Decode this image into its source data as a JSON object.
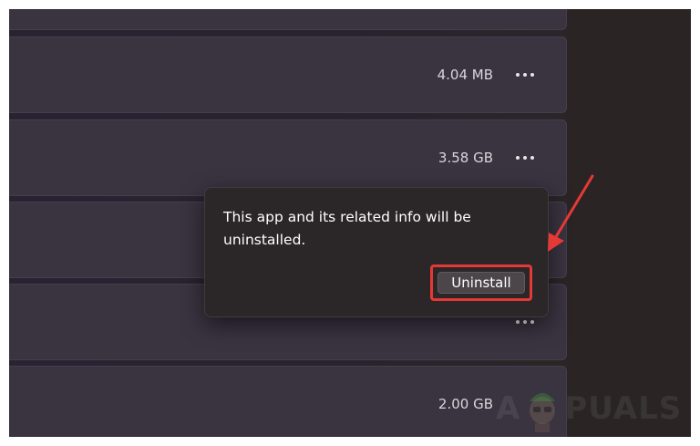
{
  "app_list": {
    "items": [
      {
        "size": ""
      },
      {
        "size": "4.04 MB"
      },
      {
        "size": "3.58 GB"
      },
      {
        "size": ""
      },
      {
        "size": ""
      },
      {
        "size": "2.00 GB"
      }
    ]
  },
  "uninstall_flyout": {
    "message": "This app and its related info will be uninstalled.",
    "button_label": "Uninstall"
  },
  "watermark": {
    "text_left": "A",
    "text_right": "PUALS"
  },
  "colors": {
    "annotation_red": "#e53935"
  }
}
